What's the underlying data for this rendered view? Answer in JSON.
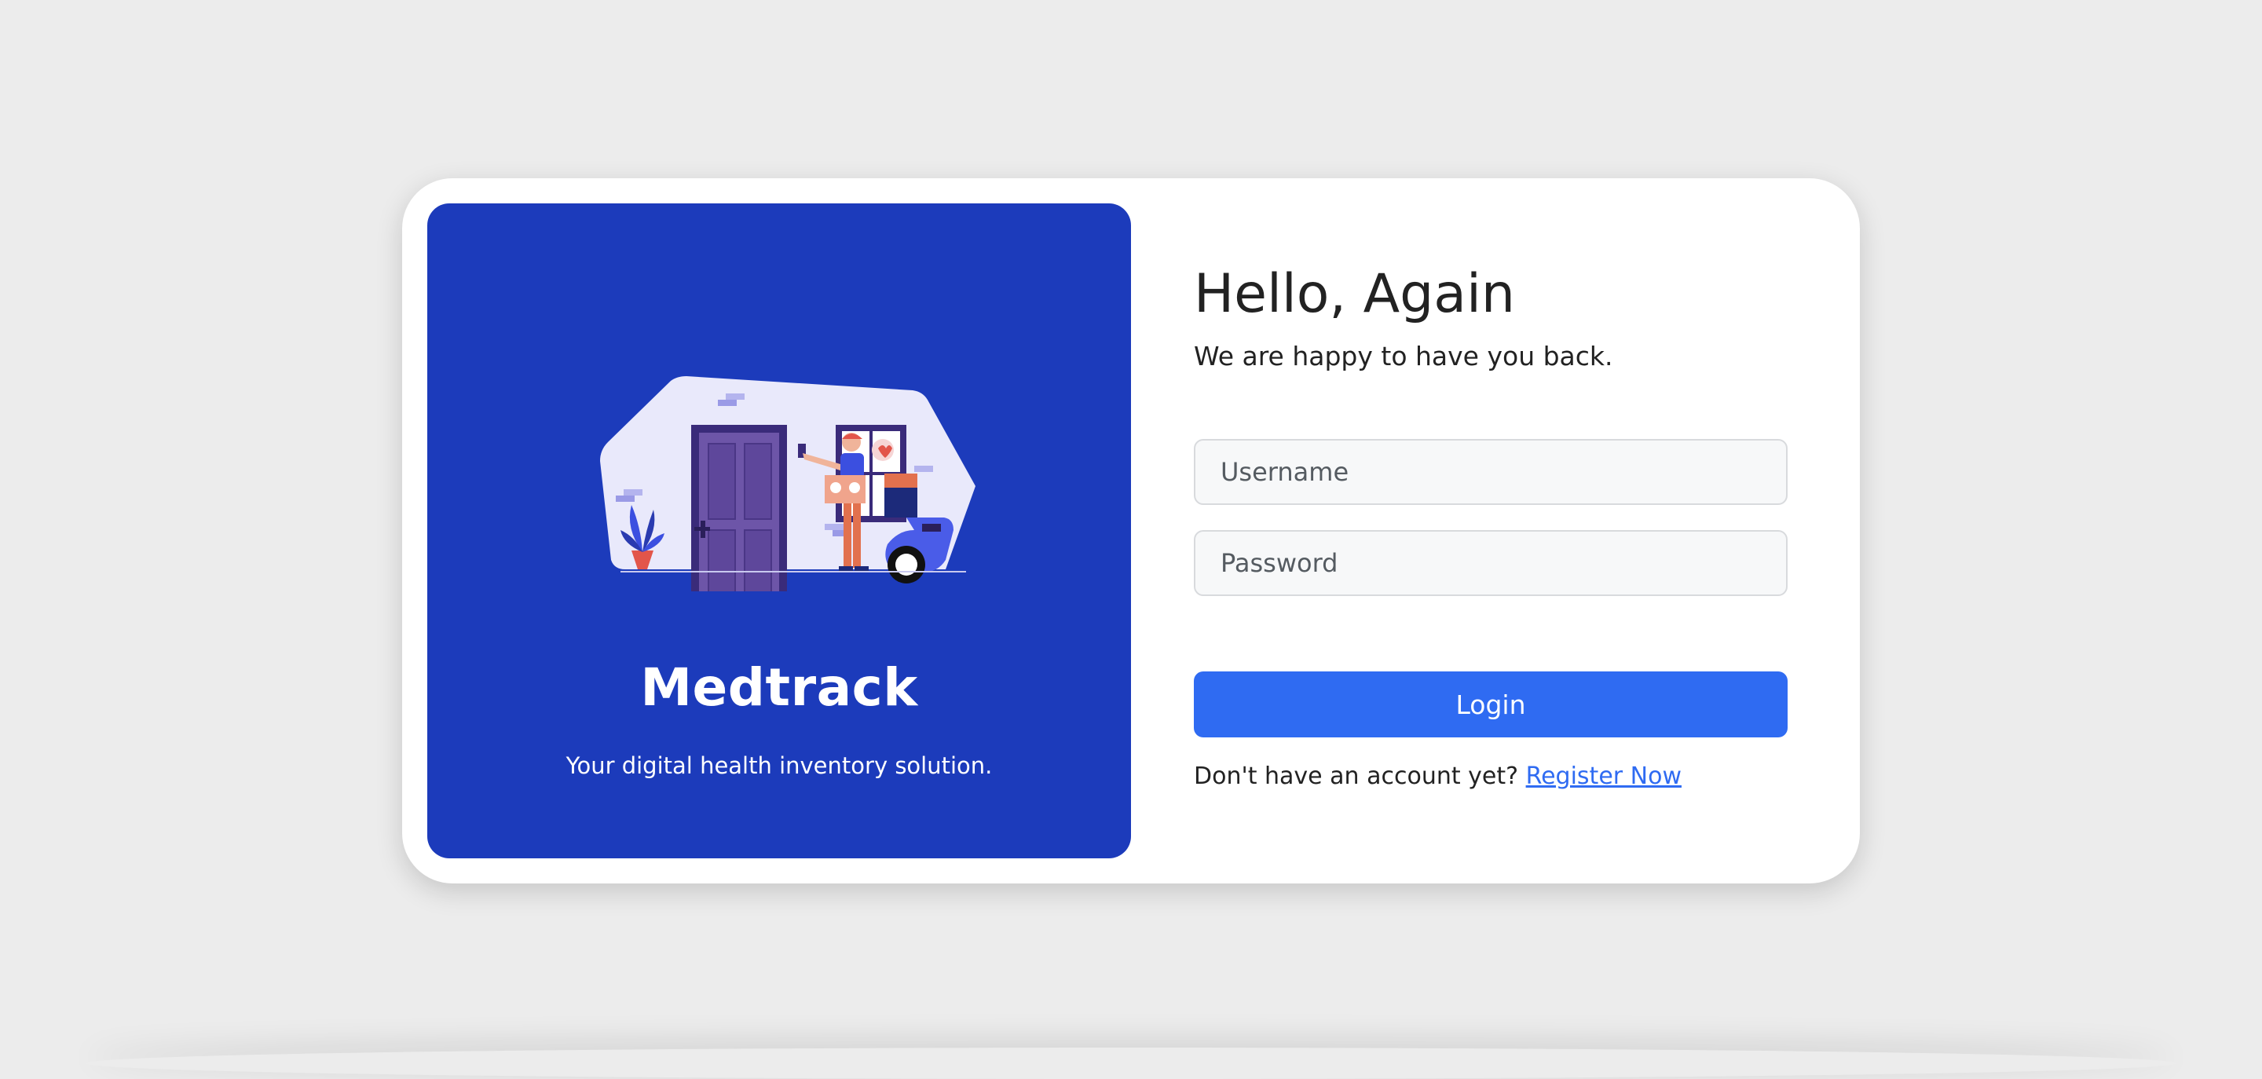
{
  "brand": {
    "name": "Medtrack",
    "tagline": "Your digital health inventory solution."
  },
  "login": {
    "heading": "Hello, Again",
    "subtitle": "We are happy to have you back.",
    "username_placeholder": "Username",
    "password_placeholder": "Password",
    "button_label": "Login",
    "register_prompt": "Don't have an account yet?",
    "register_link": "Register Now"
  },
  "colors": {
    "page_background": "#ececec",
    "brand_panel": "#1c3bbb",
    "accent": "#2f6bf2"
  },
  "illustration": {
    "icon": "delivery-person-at-door-illustration"
  }
}
